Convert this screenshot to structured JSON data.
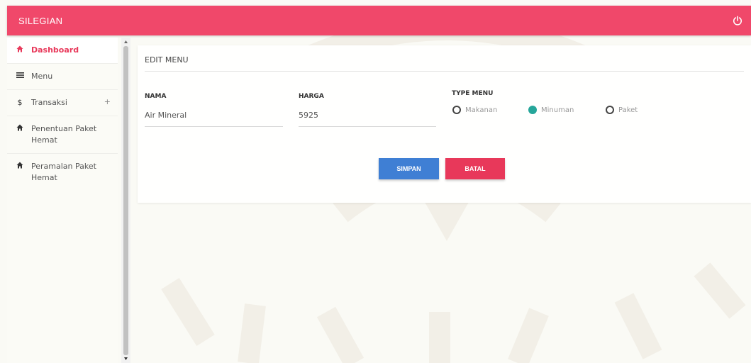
{
  "app": {
    "title": "SILEGIAN"
  },
  "colors": {
    "topbar": "#f0486a",
    "save": "#3f7fd4",
    "cancel": "#e8385a",
    "radio_checked": "#26a69a"
  },
  "sidebar": {
    "items": [
      {
        "label": "Dashboard",
        "icon": "home-icon"
      },
      {
        "label": "Menu",
        "icon": "list-icon"
      },
      {
        "label": "Transaksi",
        "icon": "dollar-icon",
        "expand": "+"
      },
      {
        "label": "Penentuan Paket Hemat",
        "icon": "home-icon"
      },
      {
        "label": "Peramalan Paket Hemat",
        "icon": "home-icon"
      }
    ]
  },
  "form": {
    "title": "EDIT MENU",
    "nama": {
      "label": "NAMA",
      "value": "Air Mineral"
    },
    "harga": {
      "label": "HARGA",
      "value": "5925"
    },
    "type": {
      "label": "TYPE MENU",
      "options": [
        "Makanan",
        "Minuman",
        "Paket"
      ],
      "selected": "Minuman"
    },
    "save_label": "SIMPAN",
    "cancel_label": "BATAL"
  }
}
